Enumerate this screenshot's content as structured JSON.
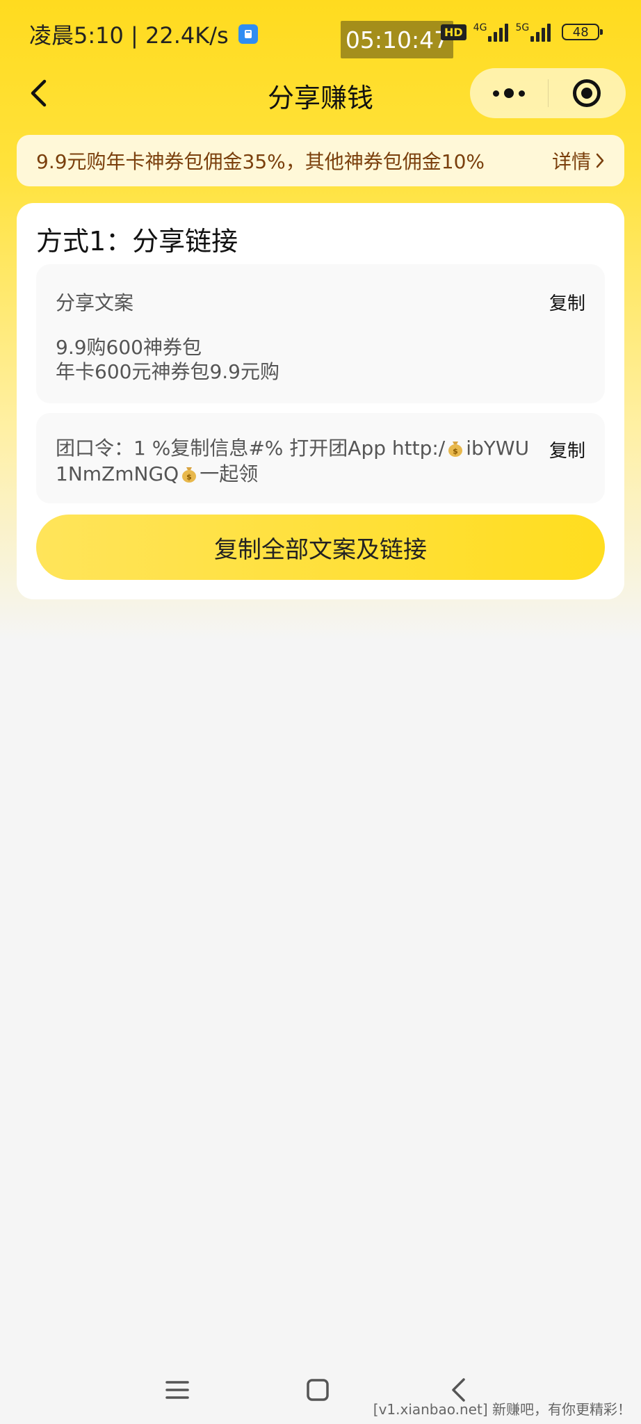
{
  "status_bar": {
    "left_text": "凌晨5:10 | 22.4K/s",
    "time_overlay": "05:10:47",
    "hd_label": "HD",
    "net1_label": "4G",
    "net2_label": "5G",
    "battery": "48"
  },
  "nav": {
    "title": "分享赚钱"
  },
  "banner": {
    "text": "9.9元购年卡神券包佣金35%，其他神券包佣金10%",
    "detail_label": "详情"
  },
  "card": {
    "title": "方式1：分享链接",
    "share_copy": {
      "label": "分享文案",
      "copy_label": "复制",
      "line1": "9.9购600神券包",
      "line2": "年卡600元神券包9.9元购"
    },
    "group_code": {
      "text_part1": "团口令：1 %复制信息#% 打开团App http:/",
      "text_part2": "ibYWU1NmZmNGQ",
      "text_part3": "一起领",
      "copy_label": "复制"
    },
    "copy_all_label": "复制全部文案及链接"
  },
  "footer": {
    "watermark": "[v1.xianbao.net] 新赚吧，有你更精彩！"
  },
  "colors": {
    "brand_yellow": "#ffdb1f",
    "banner_bg": "#fff8d8",
    "banner_text": "#7a3f0c"
  },
  "icons": {
    "back": "chevron-left-icon",
    "more": "more-dots-icon",
    "close_miniapp": "target-icon",
    "money_bag": "money-bag-icon",
    "menu": "menu-icon",
    "home": "home-square-icon",
    "sys_back": "back-icon"
  }
}
